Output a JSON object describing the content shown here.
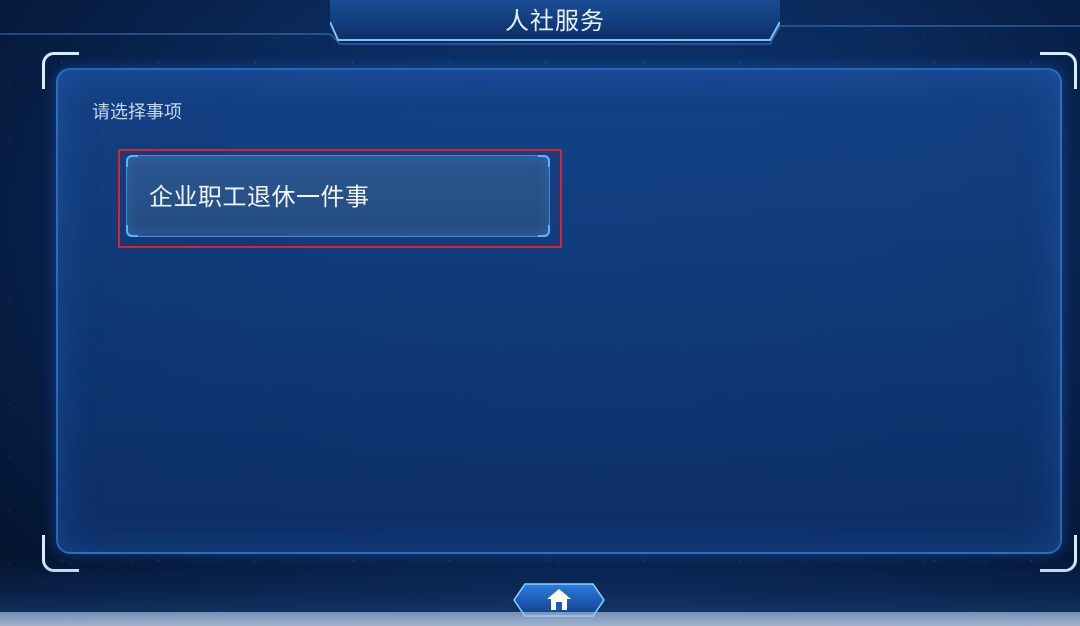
{
  "header": {
    "title": "人社服务"
  },
  "main": {
    "prompt": "请选择事项",
    "items": [
      {
        "label": "企业职工退休一件事",
        "highlighted": true
      }
    ]
  },
  "footer": {
    "home_icon": "home-icon"
  },
  "colors": {
    "background": "#0a2a5c",
    "panel": "#16468c",
    "accent": "#5fb1ff",
    "highlight": "#e0202c",
    "text": "#f2f6fb"
  }
}
